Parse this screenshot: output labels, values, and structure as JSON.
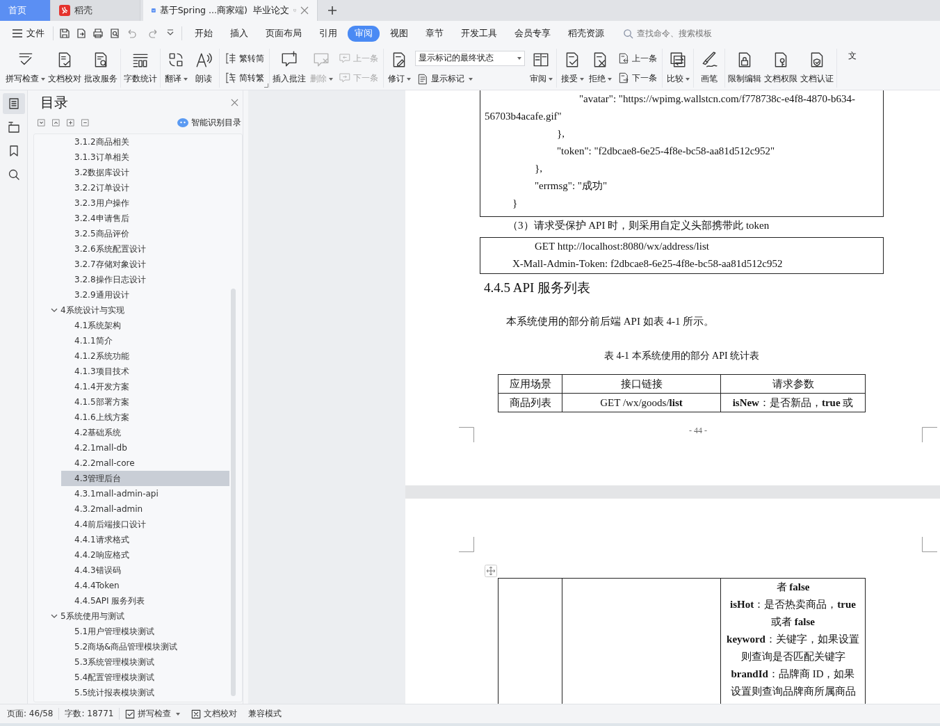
{
  "tabs": [
    {
      "label": "首页",
      "kind": "home",
      "selected": false
    },
    {
      "label": "稻壳",
      "kind": "docer",
      "selected": false
    },
    {
      "label": "基于Spring ...商家端)  毕业论文",
      "kind": "document",
      "selected": true
    }
  ],
  "menu": {
    "file": "文件",
    "items": [
      {
        "label": "开始",
        "selected": false
      },
      {
        "label": "插入",
        "selected": false
      },
      {
        "label": "页面布局",
        "selected": false
      },
      {
        "label": "引用",
        "selected": false
      },
      {
        "label": "审阅",
        "selected": true
      },
      {
        "label": "视图",
        "selected": false
      },
      {
        "label": "章节",
        "selected": false
      },
      {
        "label": "开发工具",
        "selected": false
      },
      {
        "label": "会员专享",
        "selected": false
      },
      {
        "label": "稻壳资源",
        "selected": false
      }
    ],
    "search": {
      "placeholder": "查找命令、搜索模板"
    }
  },
  "ribbon": {
    "groups": [
      {
        "items": [
          {
            "kind": "large",
            "label": "拼写检查",
            "caret": true,
            "disabled": false
          },
          {
            "kind": "large",
            "label": "文档校对",
            "caret": false,
            "disabled": false
          },
          {
            "kind": "large",
            "label": "批改服务",
            "caret": false,
            "disabled": false
          }
        ]
      },
      {
        "items": [
          {
            "kind": "large",
            "label": "字数统计",
            "caret": false,
            "disabled": false
          }
        ]
      },
      {
        "items": [
          {
            "kind": "large",
            "label": "翻译",
            "caret": true,
            "disabled": false
          },
          {
            "kind": "large",
            "label": "朗读",
            "caret": false,
            "disabled": false
          }
        ]
      },
      {
        "launcher": true,
        "items": [
          {
            "kind": "stack",
            "items": [
              {
                "label": "繁转简",
                "caret": false,
                "disabled": false
              },
              {
                "label": "简转繁",
                "caret": false,
                "disabled": false
              }
            ]
          }
        ]
      },
      {
        "items": [
          {
            "kind": "large",
            "label": "插入批注",
            "caret": false,
            "disabled": false
          },
          {
            "kind": "large",
            "label": "删除",
            "caret": true,
            "disabled": true
          },
          {
            "kind": "stack",
            "items": [
              {
                "label": "上一条",
                "caret": false,
                "disabled": true
              },
              {
                "label": "下一条",
                "caret": false,
                "disabled": true
              }
            ]
          }
        ]
      },
      {
        "items": [
          {
            "kind": "large",
            "label": "修订",
            "caret": true,
            "disabled": false
          },
          {
            "kind": "select_stack",
            "value": "显示标记的最终状态",
            "items": [
              {
                "label": "显示标记",
                "caret": true,
                "disabled": false
              }
            ]
          },
          {
            "kind": "large",
            "label": "审阅",
            "caret": true,
            "disabled": false
          }
        ]
      },
      {
        "items": [
          {
            "kind": "large",
            "label": "接受",
            "caret": true,
            "disabled": false
          },
          {
            "kind": "large",
            "label": "拒绝",
            "caret": true,
            "disabled": false
          },
          {
            "kind": "stack",
            "items": [
              {
                "label": "上一条",
                "caret": false,
                "disabled": false
              },
              {
                "label": "下一条",
                "caret": false,
                "disabled": false
              }
            ]
          }
        ]
      },
      {
        "items": [
          {
            "kind": "large",
            "label": "比较",
            "caret": true,
            "disabled": false
          }
        ]
      },
      {
        "items": [
          {
            "kind": "large",
            "label": "画笔",
            "caret": false,
            "disabled": false
          }
        ]
      },
      {
        "items": [
          {
            "kind": "large",
            "label": "限制编辑",
            "caret": false,
            "disabled": false
          },
          {
            "kind": "large",
            "label": "文档权限",
            "caret": false,
            "disabled": false
          },
          {
            "kind": "large",
            "label": "文档认证",
            "caret": false,
            "disabled": false
          }
        ]
      },
      {
        "items": [
          {
            "kind": "large",
            "label": "文",
            "caret": false,
            "disabled": false
          }
        ]
      }
    ]
  },
  "sidebar": {
    "tools": [
      {
        "selected": true
      },
      {
        "selected": false
      },
      {
        "selected": false
      },
      {
        "selected": false
      }
    ]
  },
  "toc": {
    "title": "目录",
    "smart_button": "智能识别目录",
    "items": [
      {
        "children": [
          {
            "label": "3.1.2商品相关",
            "selected": false
          },
          {
            "label": "3.1.3订单相关",
            "selected": false
          },
          {
            "label": "3.2数据库设计",
            "selected": false
          },
          {
            "label": "3.2.2订单设计",
            "selected": false
          },
          {
            "label": "3.2.3用户操作",
            "selected": false
          },
          {
            "label": "3.2.4申请售后",
            "selected": false
          },
          {
            "label": "3.2.5商品评价",
            "selected": false
          },
          {
            "label": "3.2.6系统配置设计",
            "selected": false
          },
          {
            "label": "3.2.7存储对象设计",
            "selected": false
          },
          {
            "label": "3.2.8操作日志设计",
            "selected": false
          },
          {
            "label": "3.2.9通用设计",
            "selected": false
          }
        ]
      },
      {
        "label": "4系统设计与实现",
        "selected": false,
        "expanded": true,
        "children": [
          {
            "label": "4.1系统架构",
            "selected": false
          },
          {
            "label": "4.1.1简介",
            "selected": false
          },
          {
            "label": "4.1.2系统功能",
            "selected": false
          },
          {
            "label": "4.1.3项目技术",
            "selected": false
          },
          {
            "label": "4.1.4开发方案",
            "selected": false
          },
          {
            "label": "4.1.5部署方案",
            "selected": false
          },
          {
            "label": "4.1.6上线方案",
            "selected": false
          },
          {
            "label": "4.2基础系统",
            "selected": false
          },
          {
            "label": "4.2.1mall-db",
            "selected": false
          },
          {
            "label": "4.2.2mall-core",
            "selected": false
          },
          {
            "label": "4.3管理后台",
            "selected": true
          },
          {
            "label": "4.3.1mall-admin-api",
            "selected": false
          },
          {
            "label": "4.3.2mall-admin",
            "selected": false
          },
          {
            "label": "4.4前后端接口设计",
            "selected": false
          },
          {
            "label": "4.4.1请求格式",
            "selected": false
          },
          {
            "label": "4.4.2响应格式",
            "selected": false
          },
          {
            "label": "4.4.3错误码",
            "selected": false
          },
          {
            "label": "4.4.4Token",
            "selected": false
          },
          {
            "label": "4.4.5API 服务列表",
            "selected": false
          }
        ]
      },
      {
        "label": "5系统使用与测试",
        "selected": false,
        "expanded": true,
        "children": [
          {
            "label": "5.1用户管理模块测试",
            "selected": false
          },
          {
            "label": "5.2商场&商品管理模块测试",
            "selected": false
          },
          {
            "label": "5.3系统管理模块测试",
            "selected": false
          },
          {
            "label": "5.4配置管理模块测试",
            "selected": false
          },
          {
            "label": "5.5统计报表模块测试",
            "selected": false
          }
        ]
      }
    ]
  },
  "document": {
    "pages": [
      {
        "page_number": "- 44 -",
        "blocks": [
          {
            "kind": "code",
            "continued": true,
            "lines": [
              {
                "children": [
                  {
                    "children": [
                      {
                        "children": [
                          {
                            "children": [
                              {
                                "text": "\"avatar\": \"https://wpimg.wallstcn.com/f778738c-e4f8-4870-b634-56703b4acafe.gif\""
                              }
                            ]
                          },
                          {
                            "text": "},"
                          },
                          {
                            "text": "\"token\": \"f2dbcae8-6e25-4f8e-bc58-aa81d512c952\""
                          }
                        ]
                      },
                      {
                        "text": "},"
                      },
                      {
                        "text": "\"errmsg\": \"成功\""
                      }
                    ]
                  },
                  {
                    "text": "}"
                  }
                ]
              }
            ]
          },
          {
            "kind": "paragraph",
            "text": "（3）请求受保护  API 时，则采用自定义头部携带此  token"
          },
          {
            "kind": "code",
            "continued": false,
            "lines": [
              {
                "children": [
                  {
                    "children": [
                      {
                        "text": "GET http://localhost:8080/wx/address/list"
                      }
                    ]
                  },
                  {
                    "text": "X-Mall-Admin-Token: f2dbcae8-6e25-4f8e-bc58-aa81d512c952"
                  }
                ]
              }
            ]
          },
          {
            "kind": "heading",
            "text": "4.4.5 API 服务列表"
          },
          {
            "kind": "indented",
            "text": "本系统使用的部分前后端  API 如表  4-1 所示。"
          },
          {
            "kind": "caption",
            "text": "表 4-1 本系统使用的部分  API 统计表"
          },
          {
            "kind": "table",
            "columns": [
              "应用场景",
              "接口链接",
              "请求参数"
            ],
            "rows": [
              {
                "cells": [
                  {
                    "kind": "text",
                    "text": "商品列表"
                  },
                  {
                    "kind": "text",
                    "text": "GET  /wx/goods/**list**"
                  },
                  {
                    "kind": "text",
                    "text": "**isNew**：是否新品，**true** 或"
                  }
                ]
              }
            ]
          }
        ]
      },
      {
        "blocks": [
          {
            "kind": "table",
            "continued": true,
            "rows": [
              {
                "cells": [
                  {
                    "kind": "empty"
                  },
                  {
                    "kind": "empty"
                  },
                  {
                    "kind": "lines",
                    "lines": [
                      "者  **false**",
                      "**isHot**：是否热卖商品，**true**",
                      "或者  **false**",
                      "**keyword**：关键字，如果设置",
                      "则查询是否匹配关键字",
                      "**brandId**：品牌商 ID，如果",
                      "设置则查询品牌商所属商品"
                    ]
                  }
                ]
              }
            ]
          }
        ]
      }
    ]
  },
  "status_bar": {
    "page": "页面: 46/58",
    "words": "字数: 18771",
    "items": [
      {
        "kind": "spellcheck",
        "label": "拼写检查",
        "caret": true
      },
      {
        "kind": "proofread",
        "label": "文档校对",
        "caret": false
      }
    ],
    "mode": "兼容模式"
  }
}
